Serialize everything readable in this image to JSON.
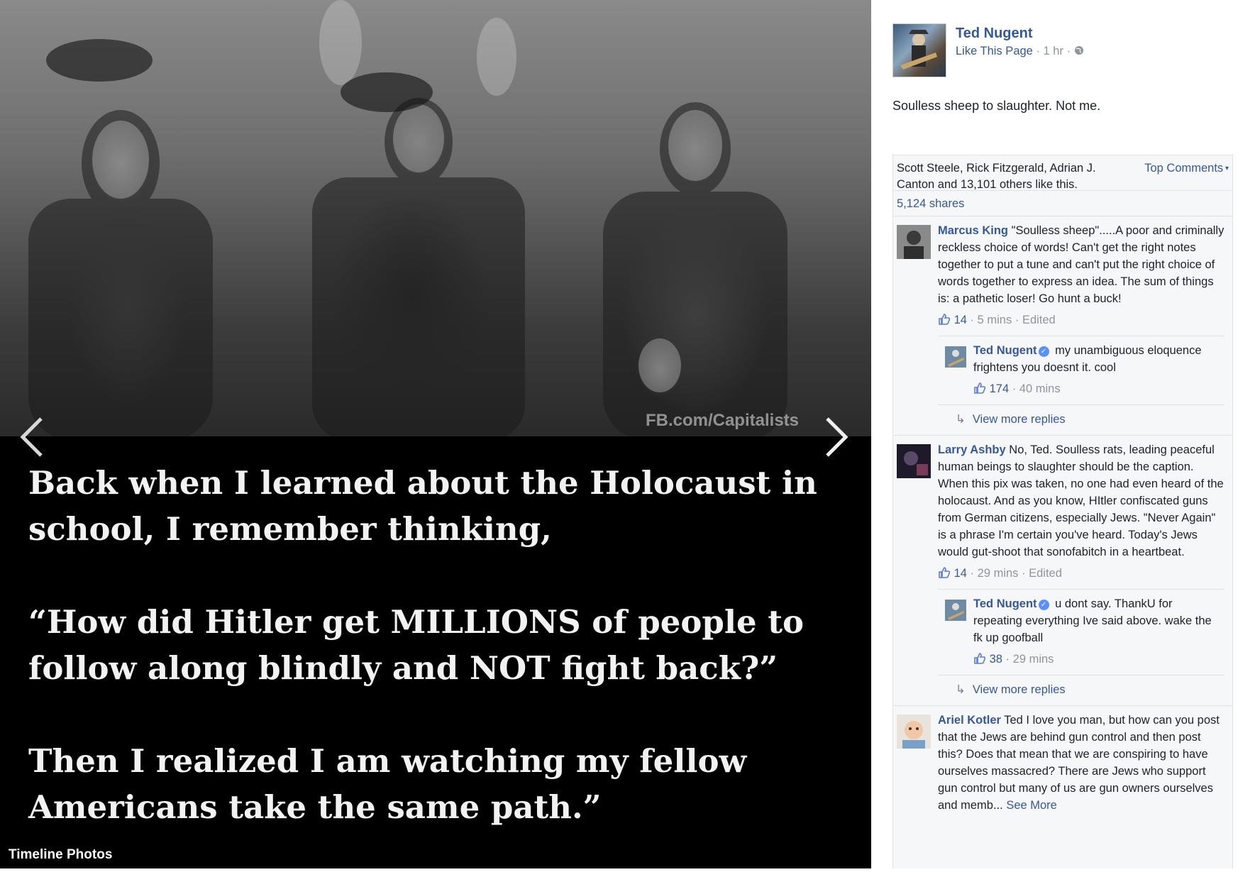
{
  "viewer": {
    "watermark": "FB.com/Capitalists",
    "caption": [
      "Back when I learned about the Holocaust in school, I remember thinking,",
      "“How did Hitler get MILLIONS of people to follow along blindly and NOT fight back?”",
      "Then I realized I am watching my fellow Americans take the same path.”"
    ],
    "album_label": "Timeline Photos",
    "close_glyph": "×"
  },
  "post": {
    "page_name": "Ted Nugent",
    "like_link": "Like This Page",
    "time": "1 hr",
    "text": "Soulless sheep to slaughter. Not me.",
    "likes_summary": "Scott Steele, Rick Fitzgerald, Adrian J. Canton and 13,101 others like this.",
    "sort_label": "Top Comments",
    "shares": "5,124 shares"
  },
  "comments": [
    {
      "author": "Marcus King",
      "text": "\"Soulless sheep\".....A poor and criminally reckless choice of words! Can't get the right notes together to put a tune and can't put the right choice of words together to express an idea. The sum of things is: a pathetic loser! Go hunt a buck!",
      "likes": "14",
      "time": "5 mins",
      "edited": "Edited",
      "reply": {
        "author": "Ted Nugent",
        "text": "my unambiguous eloquence frightens you doesnt it. cool",
        "likes": "174",
        "time": "40 mins"
      },
      "more_replies": "View more replies"
    },
    {
      "author": "Larry Ashby",
      "text": "No, Ted. Soulless rats, leading peaceful human beings to slaughter should be the caption. When this pix was taken, no one had even heard of the holocaust. And as you know, HItler confiscated guns from German citizens, especially Jews. \"Never Again\" is a phrase I'm certain you've heard. Today's Jews would gut-shoot that sonofabitch in a heartbeat.",
      "likes": "14",
      "time": "29 mins",
      "edited": "Edited",
      "reply": {
        "author": "Ted Nugent",
        "text": "u dont say. ThankU for repeating everything Ive said above. wake the fk up goofball",
        "likes": "38",
        "time": "29 mins"
      },
      "more_replies": "View more replies"
    },
    {
      "author": "Ariel Kotler",
      "text": "Ted I love you man, but how can you post that the Jews are behind gun control and then post this? Does that mean that we are conspiring to have ourselves massacred? There are Jews who support gun control but many of us are gun owners ourselves and memb...",
      "see_more": "See More"
    }
  ]
}
